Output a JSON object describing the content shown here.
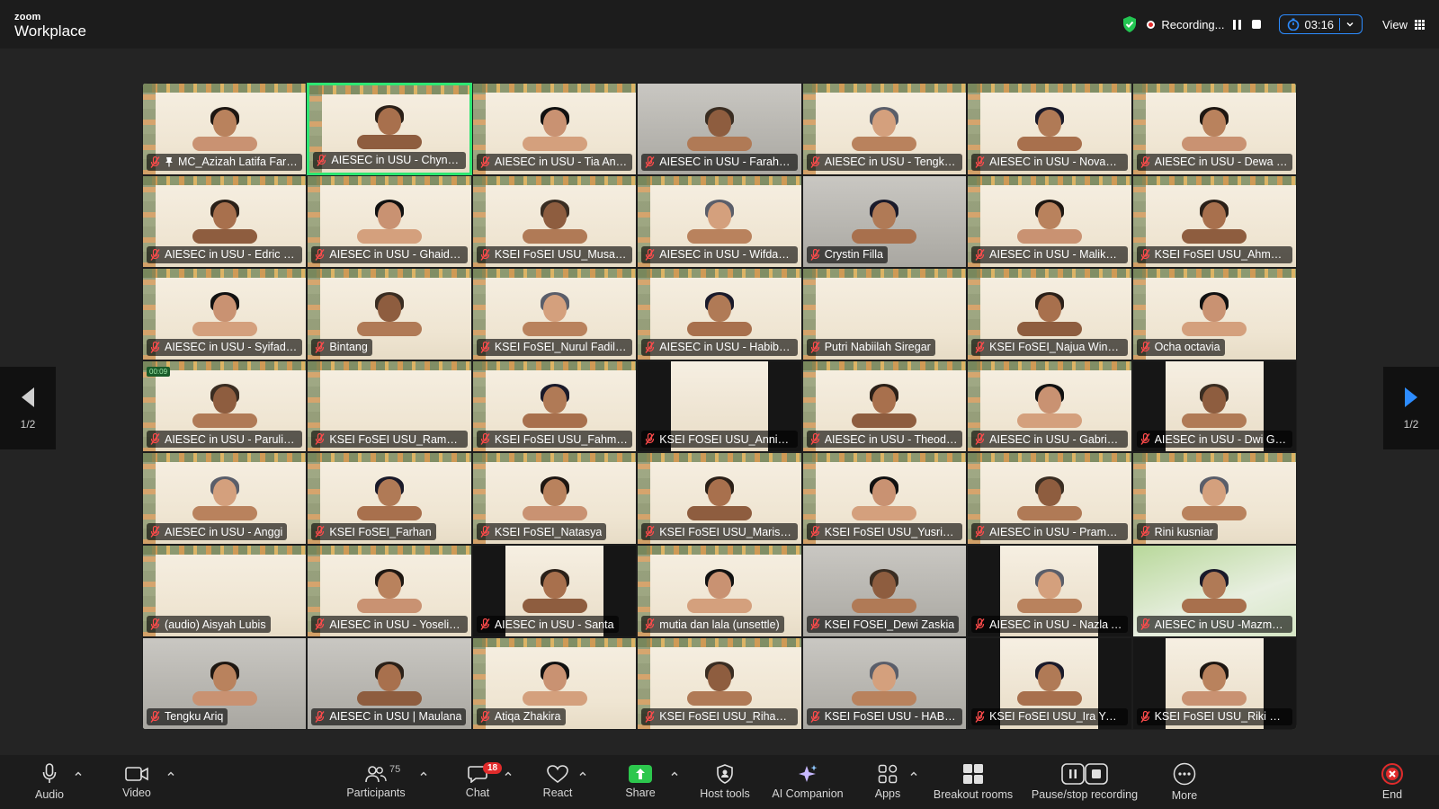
{
  "app": {
    "brand_small": "zoom",
    "brand_big": "Workplace"
  },
  "topbar": {
    "recording_label": "Recording...",
    "timer": "03:16",
    "view_label": "View"
  },
  "pager": {
    "left_label": "1/2",
    "right_label": "1/2"
  },
  "participants": [
    {
      "name": "MC_Azizah Latifa Fars...",
      "bg": "card",
      "pinned": true
    },
    {
      "name": "AIESEC in USU - Chyntia Cla...",
      "bg": "card",
      "active": true
    },
    {
      "name": "AIESEC in USU - Tia Aniss...",
      "bg": "card"
    },
    {
      "name": "AIESEC in USU - Farah Ra...",
      "bg": "photo"
    },
    {
      "name": "AIESEC in USU - Tengku ...",
      "bg": "card"
    },
    {
      "name": "AIESEC in USU - Novanka...",
      "bg": "card"
    },
    {
      "name": "AIESEC in USU - Dewa M...",
      "bg": "card"
    },
    {
      "name": "AIESEC in USU - Edric Rol...",
      "bg": "card"
    },
    {
      "name": "AIESEC in USU - Ghaida T...",
      "bg": "card"
    },
    {
      "name": "KSEI FoSEI USU_Musa Ca...",
      "bg": "card"
    },
    {
      "name": "AIESEC in USU - Wifdania...",
      "bg": "card"
    },
    {
      "name": "Crystin Filla",
      "bg": "photo"
    },
    {
      "name": "AIESEC in USU - Malika Ta...",
      "bg": "card"
    },
    {
      "name": "KSEI FoSEI USU_Ahmad S...",
      "bg": "card"
    },
    {
      "name": "AIESEC in USU - Syifadian...",
      "bg": "card"
    },
    {
      "name": "Bintang",
      "bg": "card"
    },
    {
      "name": "KSEI FoSEI_Nurul Fadila N...",
      "bg": "card"
    },
    {
      "name": "AIESEC in USU - Habibah ...",
      "bg": "card"
    },
    {
      "name": "Putri Nabiilah Siregar",
      "bg": "card",
      "empty": true
    },
    {
      "name": "KSEI FoSEI_Najua Winda ...",
      "bg": "card"
    },
    {
      "name": "Ocha octavia",
      "bg": "card"
    },
    {
      "name": "AIESEC in USU - Parulian ...",
      "bg": "card",
      "chip": "00:09"
    },
    {
      "name": "KSEI FoSEI USU_Ramadani",
      "bg": "card",
      "empty": true
    },
    {
      "name": "KSEI FoSEI USU_Fahma A...",
      "bg": "card"
    },
    {
      "name": "KSEI FOSEI USU_Annisa R...",
      "bg": "dark-card",
      "empty": true
    },
    {
      "name": "AIESEC in USU - Theodor...",
      "bg": "card"
    },
    {
      "name": "AIESEC in USU - Gabriela ...",
      "bg": "card"
    },
    {
      "name": "AIESEC in USU - Dwi Garini",
      "bg": "dark-card"
    },
    {
      "name": "AIESEC in USU - Anggi",
      "bg": "card"
    },
    {
      "name": "KSEI FoSEI_Farhan",
      "bg": "card"
    },
    {
      "name": "KSEI FoSEI_Natasya",
      "bg": "card"
    },
    {
      "name": "KSEI FoSEI USU_Marissa ...",
      "bg": "card"
    },
    {
      "name": "KSEI FoSEI USU_Yusriana ...",
      "bg": "card"
    },
    {
      "name": "AIESEC in USU - Pramesti",
      "bg": "card"
    },
    {
      "name": "Rini kusniar",
      "bg": "card"
    },
    {
      "name": "(audio) Aisyah Lubis",
      "bg": "card",
      "empty": true,
      "audio": true
    },
    {
      "name": "AIESEC in USU - Yoseline ...",
      "bg": "card"
    },
    {
      "name": "AIESEC in USU - Santa",
      "bg": "dark-card"
    },
    {
      "name": "mutia dan lala (unsettle)",
      "bg": "card"
    },
    {
      "name": "KSEI FOSEI_Dewi Zaskia",
      "bg": "photo"
    },
    {
      "name": "AIESEC in USU - Nazla Ais...",
      "bg": "dark-card"
    },
    {
      "name": "AIESEC in USU -Mazmur ...",
      "bg": "green"
    },
    {
      "name": "Tengku Ariq",
      "bg": "photo"
    },
    {
      "name": "AIESEC in USU | Maulana",
      "bg": "photo"
    },
    {
      "name": "Atiqa Zhakira",
      "bg": "card"
    },
    {
      "name": "KSEI FoSEI USU_Rihadatu...",
      "bg": "card"
    },
    {
      "name": "KSEI FoSEI USU - HABIB R...",
      "bg": "photo"
    },
    {
      "name": "KSEI FoSEI USU_Ira Yusnit...",
      "bg": "dark-card"
    },
    {
      "name": "KSEI FoSEI USU_Riki Can...",
      "bg": "dark-card"
    }
  ],
  "toolbar": {
    "audio": "Audio",
    "video": "Video",
    "participants": "Participants",
    "participants_count": "75",
    "chat": "Chat",
    "chat_badge": "18",
    "react": "React",
    "share": "Share",
    "host_tools": "Host tools",
    "ai_companion": "AI Companion",
    "apps": "Apps",
    "breakout_rooms": "Breakout rooms",
    "pause_stop_recording": "Pause/stop recording",
    "more": "More",
    "end": "End"
  },
  "colors": {
    "active_speaker": "#2ee672",
    "accent": "#2d8cff",
    "record": "#e02828",
    "share": "#2cc74d",
    "end": "#e02b2b"
  }
}
